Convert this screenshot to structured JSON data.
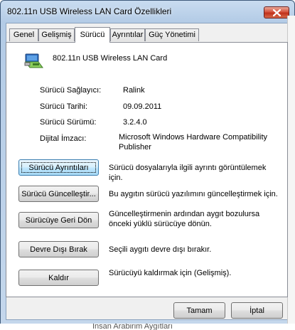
{
  "window": {
    "title": "802.11n USB Wireless LAN Card Özellikleri"
  },
  "tabs": [
    {
      "label": "Genel",
      "active": false
    },
    {
      "label": "Gelişmiş",
      "active": false
    },
    {
      "label": "Sürücü",
      "active": true
    },
    {
      "label": "Ayrıntılar",
      "active": false
    },
    {
      "label": "Güç Yönetimi",
      "active": false
    }
  ],
  "device": {
    "name": "802.11n USB Wireless LAN Card",
    "icon": "network-adapter-icon"
  },
  "driver_info": [
    {
      "label": "Sürücü Sağlayıcı:",
      "value": "Ralink"
    },
    {
      "label": "Sürücü Tarihi:",
      "value": "09.09.2011"
    },
    {
      "label": "Sürücü Sürümü:",
      "value": "3.2.4.0"
    },
    {
      "label": "Dijital İmzacı:",
      "value": "Microsoft Windows Hardware Compatibility Publisher"
    }
  ],
  "actions": [
    {
      "button": "Sürücü Ayrıntıları",
      "description": "Sürücü dosyalarıyla ilgili ayrıntı görüntülemek için."
    },
    {
      "button": "Sürücü Güncelleştir...",
      "description": "Bu aygıtın sürücü yazılımını güncelleştirmek için."
    },
    {
      "button": "Sürücüye Geri Dön",
      "description": "Güncelleştirmenin ardından aygıt bozulursa önceki yüklü sürücüye dönün."
    },
    {
      "button": "Devre Dışı Bırak",
      "description": "Seçili aygıtı devre dışı bırakır."
    },
    {
      "button": "Kaldır",
      "description": "Sürücüyü kaldırmak için (Gelişmiş)."
    }
  ],
  "footer": {
    "ok_label": "Tamam",
    "cancel_label": "İptal"
  },
  "background_text": "İnsan Arabirim Aygıtları"
}
